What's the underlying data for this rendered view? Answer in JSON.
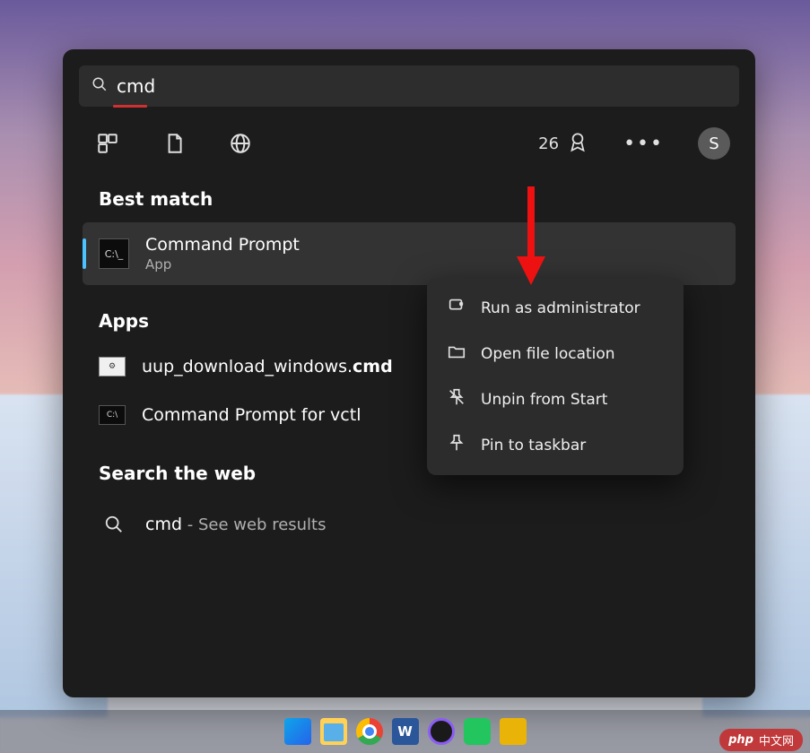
{
  "search": {
    "query": "cmd"
  },
  "rewards": {
    "points": "26"
  },
  "profile": {
    "initial": "S"
  },
  "sections": {
    "best_match": "Best match",
    "apps": "Apps",
    "web": "Search the web"
  },
  "best_match": {
    "title": "Command Prompt",
    "subtitle": "App"
  },
  "apps": [
    {
      "prefix": "uup_download_windows.",
      "bold": "cmd"
    },
    {
      "prefix": "Command Prompt for vctl",
      "bold": ""
    }
  ],
  "web_result": {
    "term": "cmd",
    "suffix": " - See web results"
  },
  "context_menu": {
    "run_admin": "Run as administrator",
    "open_location": "Open file location",
    "unpin_start": "Unpin from Start",
    "pin_taskbar": "Pin to taskbar"
  },
  "watermark": {
    "brand": "php",
    "text": "中文网"
  }
}
